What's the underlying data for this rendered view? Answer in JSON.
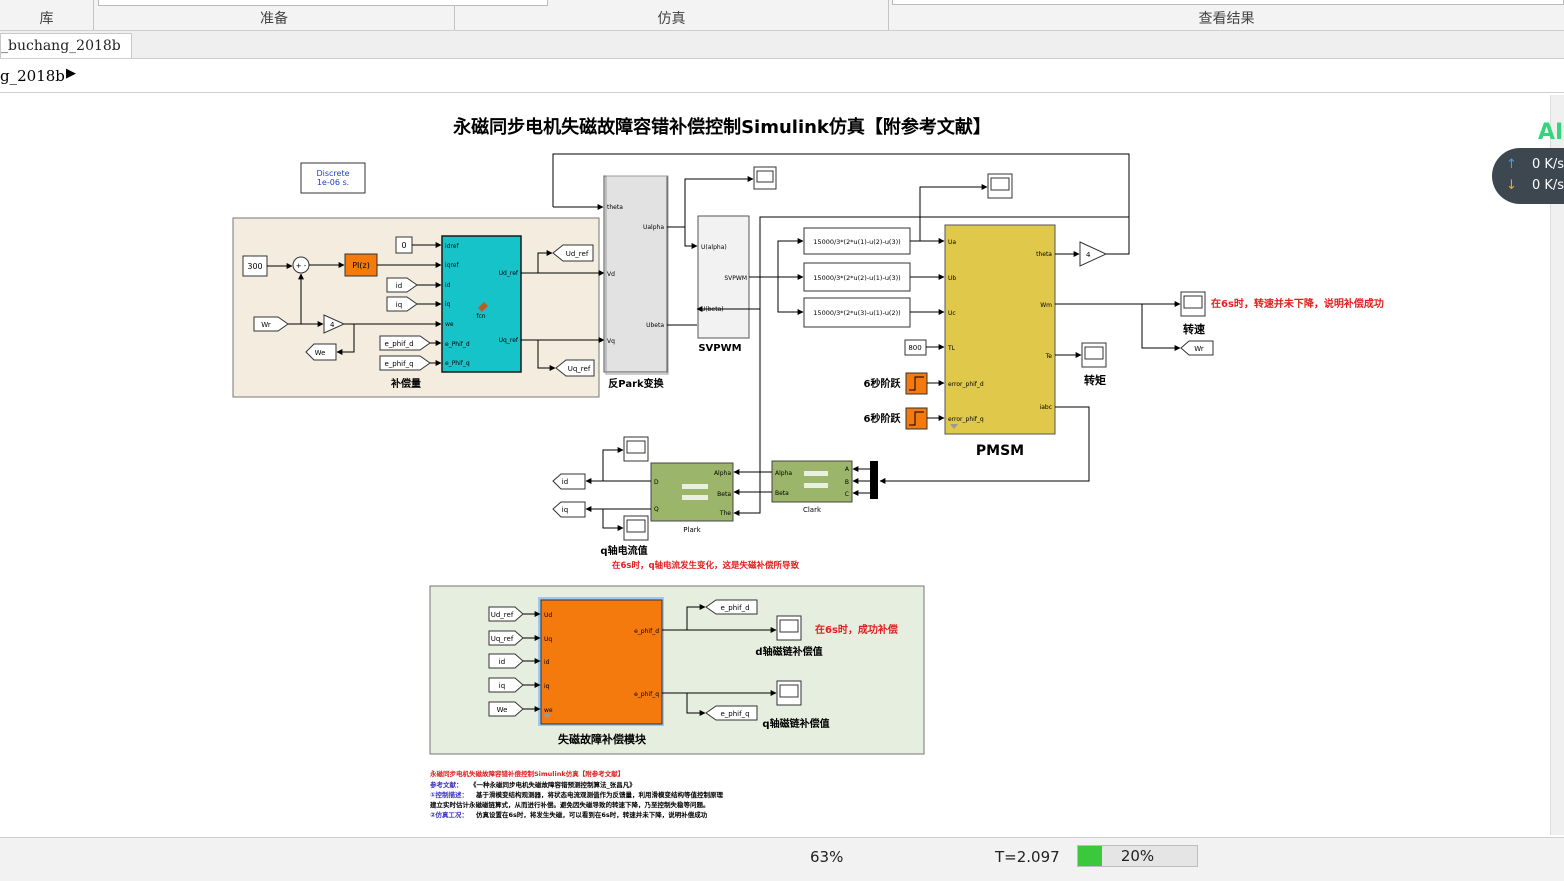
{
  "toolstrip": {
    "sections": [
      "库",
      "准备",
      "仿真",
      "查看结果"
    ]
  },
  "tab": {
    "label": "_buchang_2018b"
  },
  "address": {
    "path": "g_2018b"
  },
  "diagram": {
    "title": "永磁同步电机失磁故障容错补偿控制Simulink仿真【附参考文献】",
    "discrete": {
      "line1": "Discrete",
      "line2": "1e-06 s."
    },
    "compensation": {
      "label": "补偿量",
      "const_300": "300",
      "const_0": "0",
      "pi": "PI(z)",
      "sum": "+ -",
      "gain": "4",
      "fcn": "fcn",
      "inputs": [
        "Wr",
        "We",
        "id",
        "iq",
        "e_phif_d",
        "e_phif_q"
      ],
      "ports_in": [
        "idref",
        "iqref",
        "id",
        "iq",
        "we",
        "e_Phif_d",
        "e_Phif_q"
      ],
      "ports_out": [
        "Ud_ref",
        "Uq_ref"
      ],
      "goto": [
        "Ud_ref",
        "Uq_ref"
      ]
    },
    "ipark": {
      "label": "反Park变换",
      "ports_in": [
        "theta",
        "Vd",
        "Vq"
      ],
      "ports_out": [
        "Ualpha",
        "Ubeta"
      ]
    },
    "svpwm": {
      "label": "SVPWM",
      "ports_in": [
        "U(alpha)",
        "U(beta)"
      ],
      "out": "SVPWM"
    },
    "fcns": [
      "15000/3*(2*u(1)-u(2)-u(3))",
      "15000/3*(2*u(2)-u(1)-u(3))",
      "15000/3*(2*u(3)-u(1)-u(2))"
    ],
    "pmsm": {
      "label": "PMSM",
      "ports_in": [
        "Ua",
        "Ub",
        "Uc",
        "TL",
        "error_phif_d",
        "error_phif_q"
      ],
      "ports_out": [
        "theta",
        "Wm",
        "Te",
        "iabc"
      ],
      "tl": "800",
      "step_label": "6秒阶跃"
    },
    "theta_gain": "4",
    "speed": {
      "label": "转速",
      "goto": "Wr",
      "note": "在6s时，转速并未下降，说明补偿成功"
    },
    "torque": {
      "label": "转矩"
    },
    "park": {
      "label": "Plark",
      "ports_in": [
        "Alpha",
        "Beta",
        "The"
      ],
      "ports_out": [
        "D",
        "Q"
      ]
    },
    "clark": {
      "label": "Clark",
      "ports_in": [
        "A",
        "B",
        "C"
      ],
      "ports_out": [
        "Alpha",
        "Beta"
      ]
    },
    "currents": {
      "id": "id",
      "iq": "iq",
      "label": "q轴电流值",
      "note": "在6s时，q轴电流发生变化，这是失磁补偿所导致"
    },
    "fault": {
      "label": "失磁故障补偿模块",
      "inputs": [
        "Ud_ref",
        "Uq_ref",
        "id",
        "iq",
        "We"
      ],
      "ports_in": [
        "Ud",
        "Uq",
        "id",
        "iq",
        "we"
      ],
      "ports_out": [
        "e_phif_d",
        "e_phif_q"
      ],
      "goto": [
        "e_phif_d",
        "e_phif_q"
      ],
      "d_label": "d轴磁链补偿值",
      "q_label": "q轴磁链补偿值",
      "note": "在6s时，成功补偿"
    },
    "notes": {
      "line1": "永磁同步电机失磁故障容错补偿控制Simulink仿真【附参考文献】",
      "line2a": "参考文献：",
      "line2b": "《一种永磁同步电机失磁故障容错预测控制算法_张昌凡》",
      "line3a": "①控制描述：",
      "line3b": "基于滑模变结构观测器，将状态电流观测值作为反馈量，利用滑模变结构等值控制原理",
      "line4": "建立实时估计永磁磁链算式，从而进行补偿。避免因失磁导致的转速下降，乃至控制失稳等问题。",
      "line5a": "②仿真工况：",
      "line5b": "仿真设置在6s时，将发生失磁，可以看到在6s时，转速并未下降，说明补偿成功"
    }
  },
  "status": {
    "zoom": "63%",
    "time": "T=2.097",
    "progress_text": "20%",
    "progress": 0.2
  },
  "network": {
    "up": "0 K/s",
    "down": "0 K/s",
    "badge": "AI"
  },
  "colors": {
    "compensation_bg": "#f3ecdf",
    "fault_bg": "#e6eedf",
    "fcn_block": "#16c3c8",
    "pmsm": "#e0c94a",
    "orange": "#f47a0e",
    "park": "#9bb56a",
    "note_red": "#e02020",
    "progress": "#3cc83c"
  }
}
